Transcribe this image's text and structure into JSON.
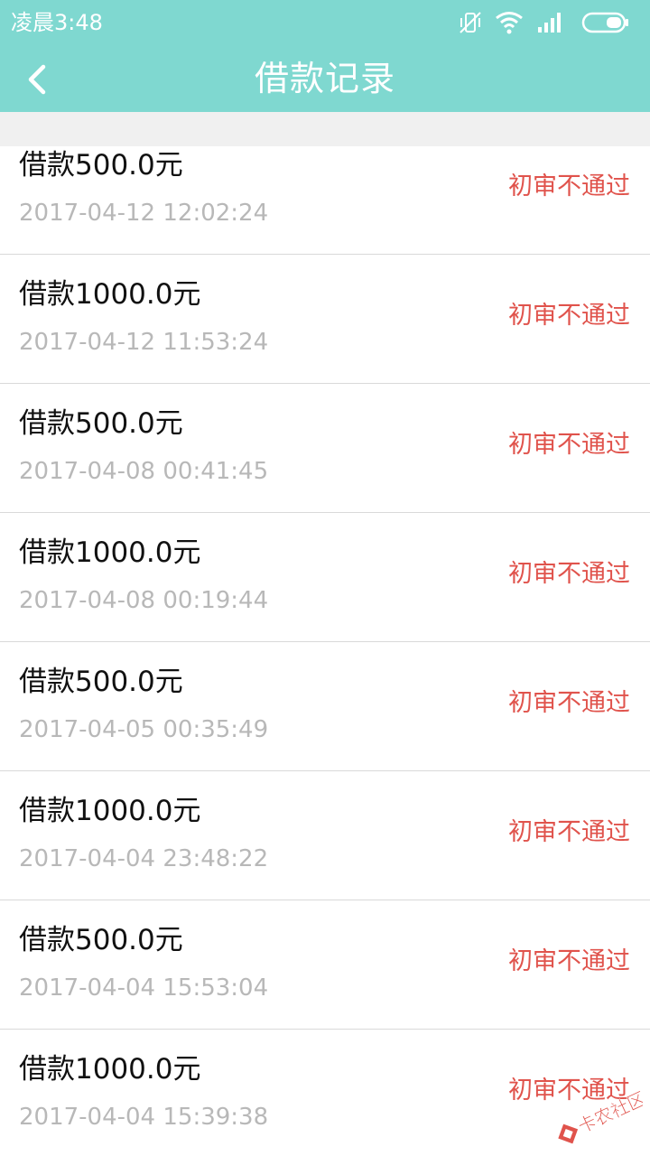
{
  "status_bar": {
    "time": "凌晨3:48",
    "icons": [
      "vibrate-off-icon",
      "wifi-icon",
      "signal-icon",
      "battery-icon"
    ]
  },
  "header": {
    "title": "借款记录",
    "back_icon": "chevron-left-icon",
    "background_color": "#7fd8d0"
  },
  "records": [
    {
      "amount": "借款500.0元",
      "datetime": "2017-04-12 12:02:24",
      "status": "初审不通过"
    },
    {
      "amount": "借款1000.0元",
      "datetime": "2017-04-12 11:53:24",
      "status": "初审不通过"
    },
    {
      "amount": "借款500.0元",
      "datetime": "2017-04-08 00:41:45",
      "status": "初审不通过"
    },
    {
      "amount": "借款1000.0元",
      "datetime": "2017-04-08 00:19:44",
      "status": "初审不通过"
    },
    {
      "amount": "借款500.0元",
      "datetime": "2017-04-05 00:35:49",
      "status": "初审不通过"
    },
    {
      "amount": "借款1000.0元",
      "datetime": "2017-04-04 23:48:22",
      "status": "初审不通过"
    },
    {
      "amount": "借款500.0元",
      "datetime": "2017-04-04 15:53:04",
      "status": "初审不通过"
    },
    {
      "amount": "借款1000.0元",
      "datetime": "2017-04-04 15:39:38",
      "status": "初审不通过"
    }
  ],
  "colors": {
    "status_text": "#e0534c",
    "date_text": "#b8b8b8"
  },
  "watermark": {
    "text": "卡农社区"
  }
}
